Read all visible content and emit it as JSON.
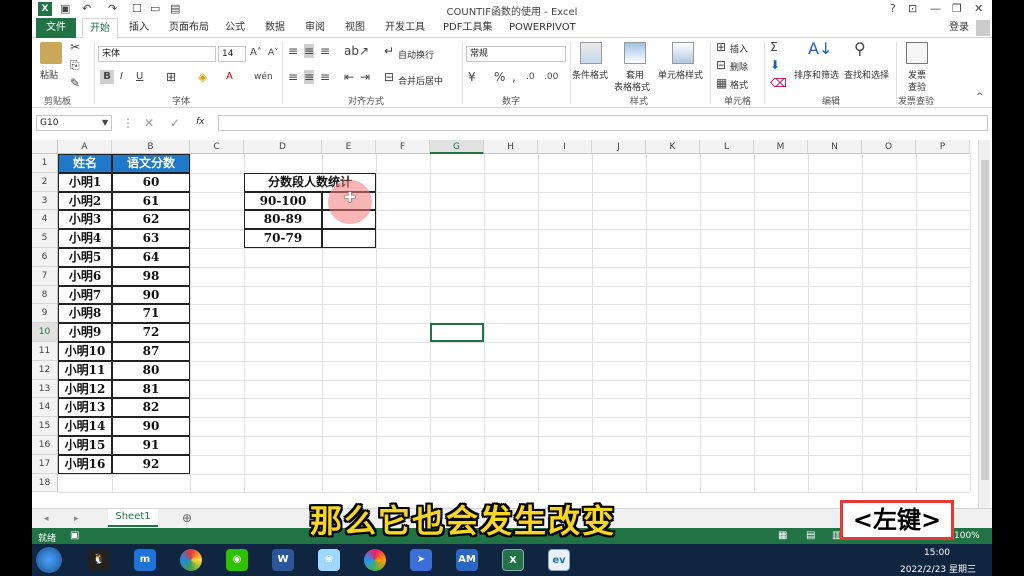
{
  "window": {
    "title": "COUNTIF函数的使用 - Excel",
    "login": "登录"
  },
  "tabs": [
    "文件",
    "开始",
    "插入",
    "页面布局",
    "公式",
    "数据",
    "审阅",
    "视图",
    "开发工具",
    "PDF工具集",
    "POWERPIVOT"
  ],
  "ribbon": {
    "paste": "粘贴",
    "font_name": "宋体",
    "font_size": "14",
    "wrap_text": "自动换行",
    "merge_center": "合并后居中",
    "number_format": "常规",
    "cond_format": "条件格式",
    "table_format_1": "套用",
    "table_format_2": "表格格式",
    "cell_style": "单元格样式",
    "insert": "插入",
    "delete": "删除",
    "format": "格式",
    "sort_filter": "排序和筛选",
    "find_select": "查找和选择",
    "invoice_1": "发票",
    "invoice_2": "查验",
    "groups": [
      "剪贴板",
      "字体",
      "对齐方式",
      "数字",
      "样式",
      "单元格",
      "编辑",
      "发票查验"
    ]
  },
  "formula_bar": {
    "name_box": "G10",
    "fx": "fx",
    "formula": ""
  },
  "columns": [
    "A",
    "B",
    "C",
    "D",
    "E",
    "F",
    "G",
    "H",
    "I",
    "J",
    "K",
    "L",
    "M",
    "N",
    "O",
    "P"
  ],
  "rows": [
    "1",
    "2",
    "3",
    "4",
    "5",
    "6",
    "7",
    "8",
    "9",
    "10",
    "11",
    "12",
    "13",
    "14",
    "15",
    "16",
    "17",
    "18"
  ],
  "table1": {
    "header_name": "姓名",
    "header_score": "语文分数",
    "rows": [
      [
        "小明1",
        "60"
      ],
      [
        "小明2",
        "61"
      ],
      [
        "小明3",
        "62"
      ],
      [
        "小明4",
        "63"
      ],
      [
        "小明5",
        "64"
      ],
      [
        "小明6",
        "98"
      ],
      [
        "小明7",
        "90"
      ],
      [
        "小明8",
        "71"
      ],
      [
        "小明9",
        "72"
      ],
      [
        "小明10",
        "87"
      ],
      [
        "小明11",
        "80"
      ],
      [
        "小明12",
        "81"
      ],
      [
        "小明13",
        "82"
      ],
      [
        "小明14",
        "90"
      ],
      [
        "小明15",
        "91"
      ],
      [
        "小明16",
        "92"
      ]
    ]
  },
  "table2": {
    "title": "分数段人数统计",
    "rows": [
      "90-100",
      "80-89",
      "70-79"
    ]
  },
  "sheet_tab": "Sheet1",
  "status": {
    "ready": "就绪",
    "zoom": "100%"
  },
  "clock": {
    "time": "15:00",
    "date": "2022/2/23 星期三"
  },
  "overlay": {
    "subtitle": "那么它也会发生改变",
    "key_hint": "<左键>"
  },
  "taskbar_labels": {
    "word": "W",
    "am": "AM",
    "excel": "X"
  }
}
